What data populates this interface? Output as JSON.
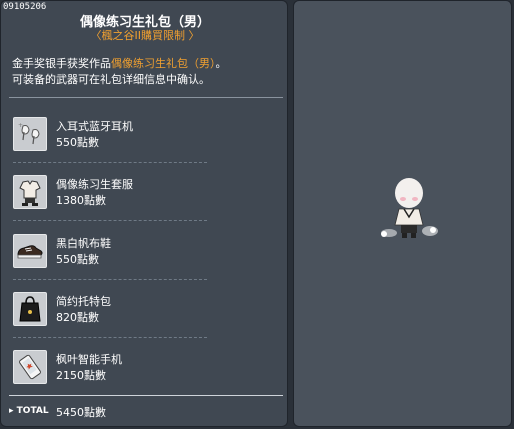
{
  "header": {
    "code": "09105206",
    "title": "偶像练习生礼包（男）",
    "subtitle": "〈楓之谷II購買限制 〉"
  },
  "description": {
    "line1_prefix": "金手奖银手获奖作品",
    "line1_highlight": "偶像练习生礼包（男）",
    "line1_suffix": "。",
    "line2": "可装备的武器可在礼包详细信息中确认。"
  },
  "items": [
    {
      "name": "入耳式蓝牙耳机",
      "price": "550點數",
      "icon": "earphones-icon"
    },
    {
      "name": "偶像练习生套服",
      "price": "1380點數",
      "icon": "outfit-icon"
    },
    {
      "name": "黑白帆布鞋",
      "price": "550點數",
      "icon": "sneaker-icon"
    },
    {
      "name": "简约托特包",
      "price": "820點數",
      "icon": "tote-bag-icon"
    },
    {
      "name": "枫叶智能手机",
      "price": "2150點數",
      "icon": "smartphone-icon"
    }
  ],
  "total": {
    "label": "TOTAL",
    "value": "5450點數"
  }
}
